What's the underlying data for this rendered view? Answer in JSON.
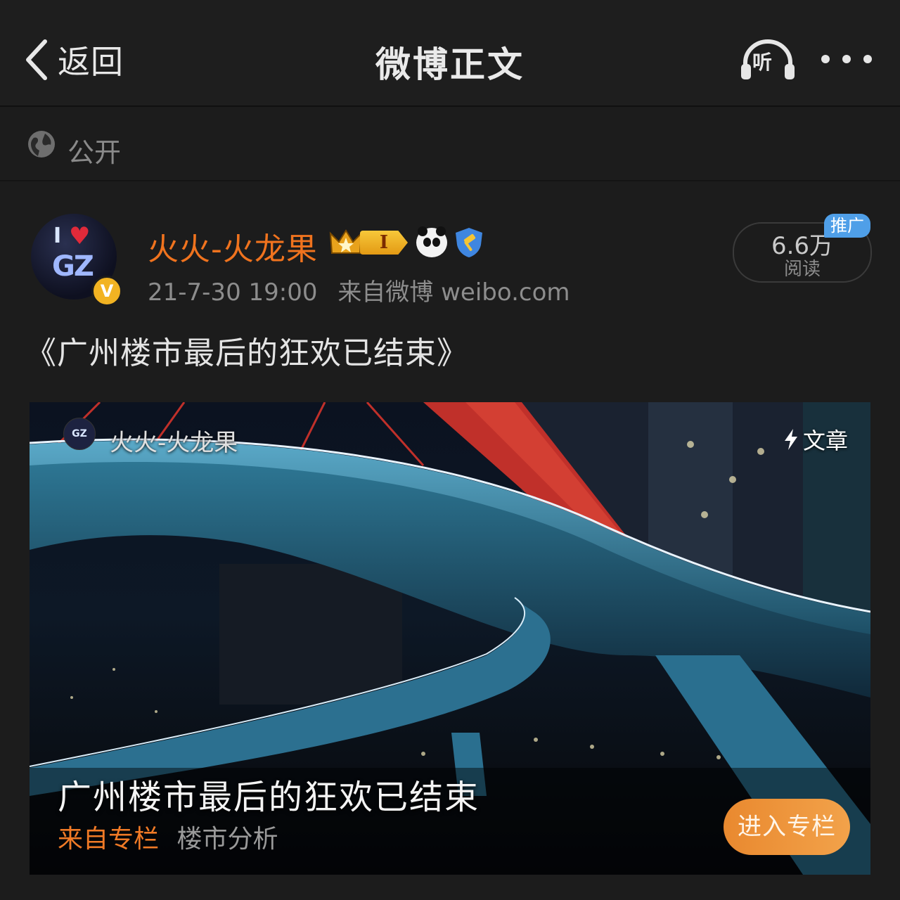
{
  "nav": {
    "back_label": "返回",
    "title": "微博正文",
    "listen_label": "听",
    "more_icon": "more-dots-icon"
  },
  "visibility": {
    "icon": "globe-icon",
    "label": "公开"
  },
  "post": {
    "author": "火火-火龙果",
    "date": "21-7-30 19:00",
    "source": "来自微博 weibo.com",
    "verified_mark": "V",
    "level_badge": "I",
    "reads": {
      "count": "6.6万",
      "label": "阅读",
      "promo_tag": "推广"
    },
    "text": "《广州楼市最后的狂欢已结束》"
  },
  "article_card": {
    "author": "火火-火龙果",
    "type_label": "文章",
    "title": "广州楼市最后的狂欢已结束",
    "from_label": "来自专栏",
    "from_value": "楼市分析",
    "enter_button": "进入专栏"
  },
  "colors": {
    "username": "#f0731e",
    "promo": "#4f9fe8",
    "enter_button": "#ee9a3c",
    "background": "#1c1c1c"
  }
}
